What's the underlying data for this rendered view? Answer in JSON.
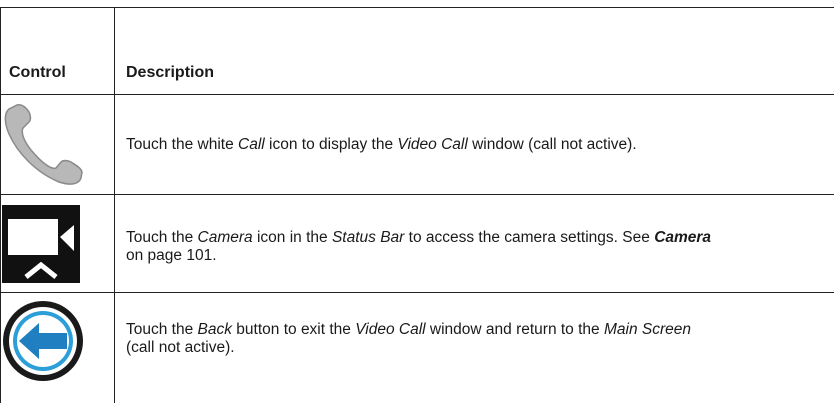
{
  "table": {
    "header": {
      "control": "Control",
      "description": "Description"
    },
    "rows": [
      {
        "icon": "phone-icon",
        "desc": {
          "p1": "Touch the white ",
          "i1": "Call",
          "p2": " icon to display the ",
          "i2": "Video Call",
          "p3": " window (call not active)."
        }
      },
      {
        "icon": "camera-icon",
        "desc": {
          "p1": "Touch the ",
          "i1": "Camera",
          "p2": " icon in the ",
          "i2": "Status Bar",
          "p3": " to access the camera settings. See ",
          "b1": "Camera",
          "p4": " on page 101."
        }
      },
      {
        "icon": "back-arrow-icon",
        "desc": {
          "p1": "Touch the ",
          "i1": "Back",
          "p2": " button to exit the ",
          "i2": "Video Call",
          "p3": " window and return to the ",
          "i3": "Main Screen",
          "p4": " (call not active)."
        }
      }
    ]
  },
  "colors": {
    "phone_icon_fill": "#b8b8b8",
    "camera_icon_bg": "#111111",
    "back_icon_ring": "#2d9fd8",
    "back_icon_arrow": "#1f7fc0"
  }
}
